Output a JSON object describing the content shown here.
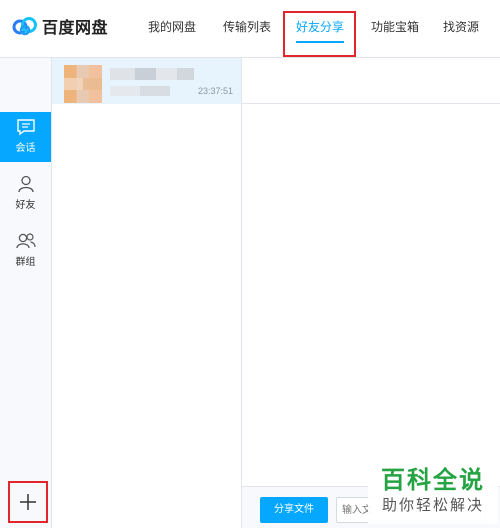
{
  "app": {
    "logo_text": "百度网盘"
  },
  "nav": {
    "tabs": [
      {
        "label": "我的网盘"
      },
      {
        "label": "传输列表"
      },
      {
        "label": "好友分享",
        "active": true
      },
      {
        "label": "功能宝箱"
      },
      {
        "label": "找资源"
      }
    ]
  },
  "sidebar": {
    "items": [
      {
        "label": "会话",
        "icon": "chat-bubble-icon",
        "active": true
      },
      {
        "label": "好友",
        "icon": "person-icon"
      },
      {
        "label": "群组",
        "icon": "group-icon"
      }
    ],
    "add_icon": "plus-icon"
  },
  "conversations": [
    {
      "time": "23:37:51"
    }
  ],
  "composer": {
    "share_label": "分享文件",
    "input_placeholder": "输入文"
  },
  "watermark": {
    "title": "百科全说",
    "subtitle": "助你轻松解决"
  },
  "colors": {
    "accent": "#06a7ff",
    "highlight": "#e3262b",
    "watermark": "#26a443"
  }
}
